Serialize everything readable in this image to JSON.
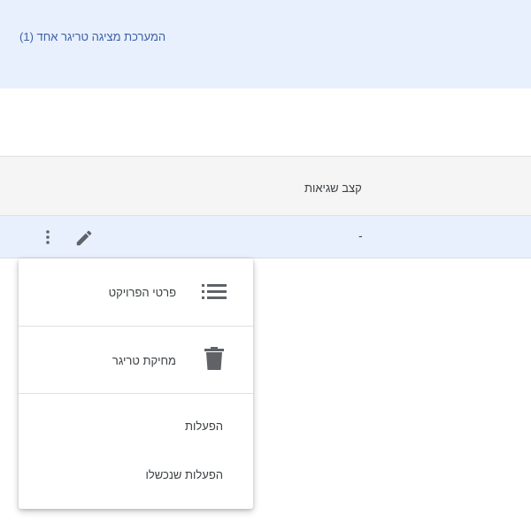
{
  "banner": {
    "text": "המערכת מציגה טריגר אחד (1)"
  },
  "table": {
    "columns": [
      {
        "label": "קצב שגיאות"
      }
    ],
    "rows": [
      {
        "error_rate": "-"
      }
    ]
  },
  "row_actions": {
    "more_icon": "more-vert-icon",
    "edit_icon": "pencil-icon"
  },
  "menu": {
    "items": [
      {
        "label": "פרטי הפרויקט",
        "icon": "list-icon"
      },
      {
        "label": "מחיקת טריגר",
        "icon": "trash-icon"
      },
      {
        "label": "הפעלות",
        "icon": ""
      },
      {
        "label": "הפעלות שנכשלו",
        "icon": ""
      }
    ]
  },
  "colors": {
    "banner_bg": "#e8f0fe",
    "banner_text": "#3c5fa5",
    "row_highlight": "#e8f0fe",
    "header_bg": "#f5f5f5",
    "icon_gray": "#5f6368"
  }
}
